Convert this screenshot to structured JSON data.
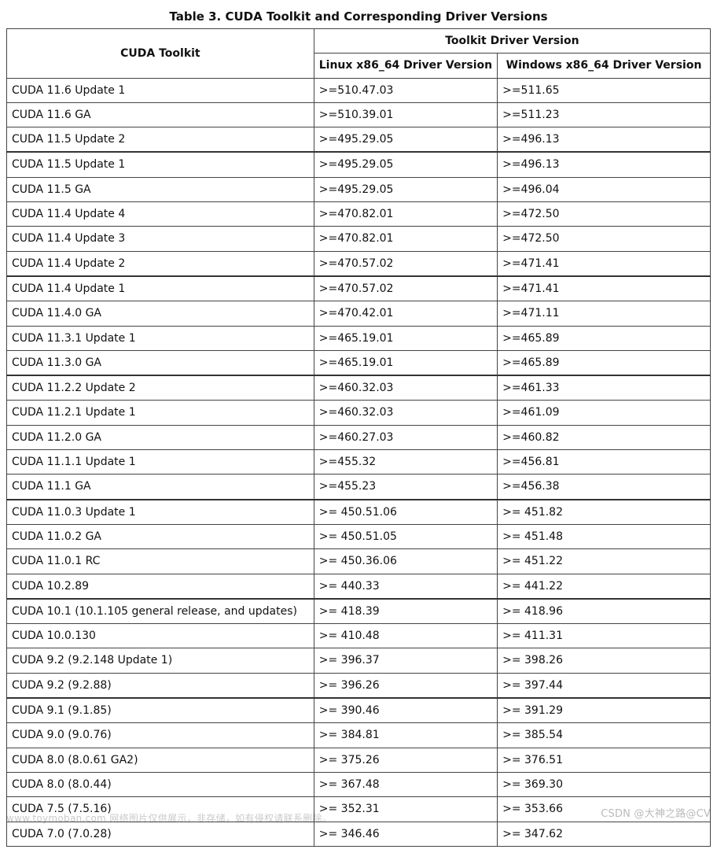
{
  "title": "Table 3. CUDA Toolkit and Corresponding Driver Versions",
  "headers": {
    "toolkit": "CUDA Toolkit",
    "group": "Toolkit Driver Version",
    "linux": "Linux x86_64 Driver Version",
    "windows": "Windows x86_64 Driver Version"
  },
  "rows": [
    {
      "toolkit": "CUDA 11.6 Update 1",
      "linux": ">=510.47.03",
      "windows": ">=511.65"
    },
    {
      "toolkit": "CUDA 11.6 GA",
      "linux": ">=510.39.01",
      "windows": ">=511.23"
    },
    {
      "toolkit": "CUDA 11.5 Update 2",
      "linux": ">=495.29.05",
      "windows": ">=496.13"
    },
    {
      "toolkit": "CUDA 11.5 Update 1",
      "linux": ">=495.29.05",
      "windows": ">=496.13"
    },
    {
      "toolkit": "CUDA 11.5 GA",
      "linux": ">=495.29.05",
      "windows": ">=496.04"
    },
    {
      "toolkit": "CUDA 11.4 Update 4",
      "linux": ">=470.82.01",
      "windows": ">=472.50"
    },
    {
      "toolkit": "CUDA 11.4 Update 3",
      "linux": ">=470.82.01",
      "windows": ">=472.50"
    },
    {
      "toolkit": "CUDA 11.4 Update 2",
      "linux": ">=470.57.02",
      "windows": ">=471.41"
    },
    {
      "toolkit": "CUDA 11.4 Update 1",
      "linux": ">=470.57.02",
      "windows": ">=471.41"
    },
    {
      "toolkit": "CUDA 11.4.0 GA",
      "linux": ">=470.42.01",
      "windows": ">=471.11"
    },
    {
      "toolkit": "CUDA 11.3.1 Update 1",
      "linux": ">=465.19.01",
      "windows": ">=465.89"
    },
    {
      "toolkit": "CUDA 11.3.0 GA",
      "linux": ">=465.19.01",
      "windows": ">=465.89"
    },
    {
      "toolkit": "CUDA 11.2.2 Update 2",
      "linux": ">=460.32.03",
      "windows": ">=461.33"
    },
    {
      "toolkit": "CUDA 11.2.1 Update 1",
      "linux": ">=460.32.03",
      "windows": ">=461.09"
    },
    {
      "toolkit": "CUDA 11.2.0 GA",
      "linux": ">=460.27.03",
      "windows": ">=460.82"
    },
    {
      "toolkit": "CUDA 11.1.1 Update 1",
      "linux": ">=455.32",
      "windows": ">=456.81"
    },
    {
      "toolkit": "CUDA 11.1 GA",
      "linux": ">=455.23",
      "windows": ">=456.38"
    },
    {
      "toolkit": "CUDA 11.0.3 Update 1",
      "linux": ">= 450.51.06",
      "windows": ">= 451.82"
    },
    {
      "toolkit": "CUDA 11.0.2 GA",
      "linux": ">= 450.51.05",
      "windows": ">= 451.48"
    },
    {
      "toolkit": "CUDA 11.0.1 RC",
      "linux": ">= 450.36.06",
      "windows": ">= 451.22"
    },
    {
      "toolkit": "CUDA 10.2.89",
      "linux": ">= 440.33",
      "windows": ">= 441.22"
    },
    {
      "toolkit": "CUDA 10.1 (10.1.105 general release, and updates)",
      "linux": ">= 418.39",
      "windows": ">= 418.96"
    },
    {
      "toolkit": "CUDA 10.0.130",
      "linux": ">= 410.48",
      "windows": ">= 411.31"
    },
    {
      "toolkit": "CUDA 9.2 (9.2.148 Update 1)",
      "linux": ">= 396.37",
      "windows": ">= 398.26"
    },
    {
      "toolkit": "CUDA 9.2 (9.2.88)",
      "linux": ">= 396.26",
      "windows": ">= 397.44"
    },
    {
      "toolkit": "CUDA 9.1 (9.1.85)",
      "linux": ">= 390.46",
      "windows": ">= 391.29"
    },
    {
      "toolkit": "CUDA 9.0 (9.0.76)",
      "linux": ">= 384.81",
      "windows": ">= 385.54"
    },
    {
      "toolkit": "CUDA 8.0 (8.0.61 GA2)",
      "linux": ">= 375.26",
      "windows": ">= 376.51"
    },
    {
      "toolkit": "CUDA 8.0 (8.0.44)",
      "linux": ">= 367.48",
      "windows": ">= 369.30"
    },
    {
      "toolkit": "CUDA 7.5 (7.5.16)",
      "linux": ">= 352.31",
      "windows": ">= 353.66"
    },
    {
      "toolkit": "CUDA 7.0 (7.0.28)",
      "linux": ">= 346.46",
      "windows": ">= 347.62"
    }
  ],
  "heavy_top_before": [
    3,
    8,
    12,
    17,
    21,
    25
  ],
  "watermarks": {
    "left": "www.toymoban.com 网络图片仅供展示，非存储，如有侵权请联系删除。",
    "right": "CSDN @大神之路@CV"
  }
}
